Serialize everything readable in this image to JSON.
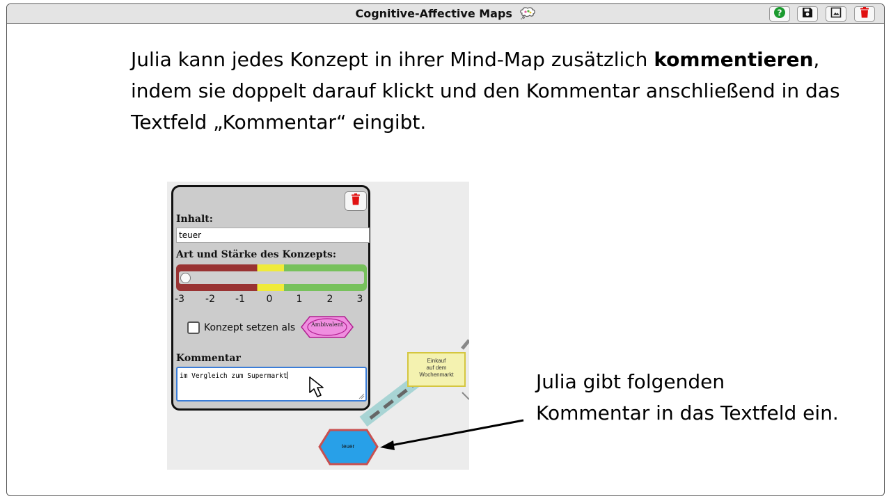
{
  "window": {
    "title": "Cognitive-Affective Maps",
    "title_icon": "thought-bubble-icon",
    "buttons": [
      {
        "name": "help-button",
        "icon": "question-circle-icon",
        "color": "#1a9a2e"
      },
      {
        "name": "save-button",
        "icon": "floppy-disk-icon",
        "color": "#111111"
      },
      {
        "name": "image-export-button",
        "icon": "image-icon",
        "color": "#222222"
      },
      {
        "name": "delete-button",
        "icon": "trash-icon",
        "color": "#e01010"
      }
    ]
  },
  "instruction": {
    "prefix": "Julia kann jedes Konzept in ihrer Mind-Map zusätzlich ",
    "bold": "kommentieren",
    "suffix": ", indem sie doppelt darauf klickt und den Kommentar anschließend in das Textfeld „Kommentar“ eingibt."
  },
  "panel": {
    "content_label": "Inhalt:",
    "content_value": "teuer",
    "type_label": "Art und Stärke des Konzepts:",
    "slider_value": -3,
    "slider_min": -3,
    "slider_max": 3,
    "scale": [
      "-3",
      "-2",
      "-1",
      "0",
      "1",
      "2",
      "3"
    ],
    "checkbox_label": "Konzept setzen als",
    "checkbox_checked": false,
    "ambivalent_label": "Ambivalent",
    "comment_label": "Kommentar",
    "comment_value": "im Vergleich zum Supermarkt"
  },
  "map": {
    "node_teuer": "teuer",
    "node_einkauf": [
      "Einkauf",
      "auf dem",
      "Wochenmarkt"
    ],
    "colors": {
      "negative": "#993333",
      "neutral": "#f0eb3a",
      "positive": "#77c15c",
      "node_fill": "#28a0e8",
      "node_border": "#c85050",
      "einkauf_fill": "#f4f2b0",
      "einkauf_border": "#d4c640"
    }
  },
  "annotation": {
    "text": "Julia gibt folgenden Kommentar in das Textfeld ein."
  }
}
